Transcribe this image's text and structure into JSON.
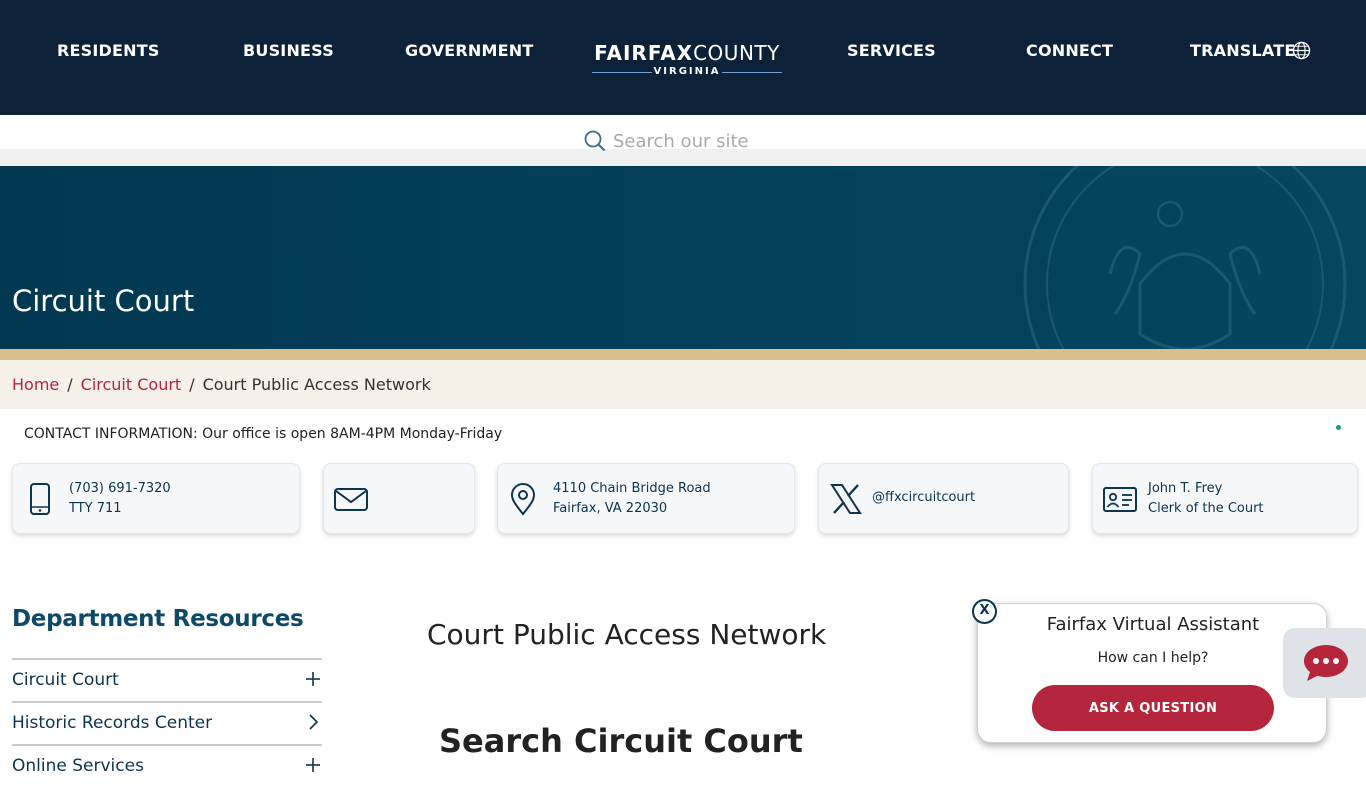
{
  "nav": {
    "residents": "RESIDENTS",
    "business": "BUSINESS",
    "government": "GOVERNMENT",
    "logo_bold": "FAIRFAX",
    "logo_light": "COUNTY",
    "logo_sub": "VIRGINIA",
    "services": "SERVICES",
    "connect": "CONNECT",
    "translate": "TRANSLATE"
  },
  "search": {
    "placeholder": "Search our site"
  },
  "hero": {
    "title": "Circuit Court"
  },
  "breadcrumb": {
    "home": "Home",
    "parent": "Circuit Court",
    "current": "Court Public Access Network",
    "separator": "/"
  },
  "contact": {
    "intro": "CONTACT INFORMATION: Our office is open 8AM-4PM Monday-Friday",
    "phone": "(703) 691-7320",
    "tty": "TTY 711",
    "address_line1": "4110 Chain Bridge Road",
    "address_line2": "Fairfax, VA 22030",
    "twitter": "@ffxcircuitcourt",
    "clerk_name": "John T. Frey",
    "clerk_title": "Clerk of the Court"
  },
  "sidebar": {
    "title": "Department Resources",
    "items": [
      {
        "label": "Circuit Court",
        "control": "expand"
      },
      {
        "label": "Historic Records Center",
        "control": "link"
      },
      {
        "label": "Online Services",
        "control": "expand"
      }
    ]
  },
  "main": {
    "heading": "Court Public Access Network",
    "subheading": "Search Circuit Court"
  },
  "assistant": {
    "title": "Fairfax Virtual Assistant",
    "prompt": "How can I help?",
    "button": "ASK A QUESTION",
    "close": "X"
  },
  "colors": {
    "nav_bg": "#0d2239",
    "hero_bg": "#023852",
    "accent_gold": "#d6c08d",
    "link_red": "#b5253b",
    "breadcrumb_bg": "#f5f0e8"
  }
}
